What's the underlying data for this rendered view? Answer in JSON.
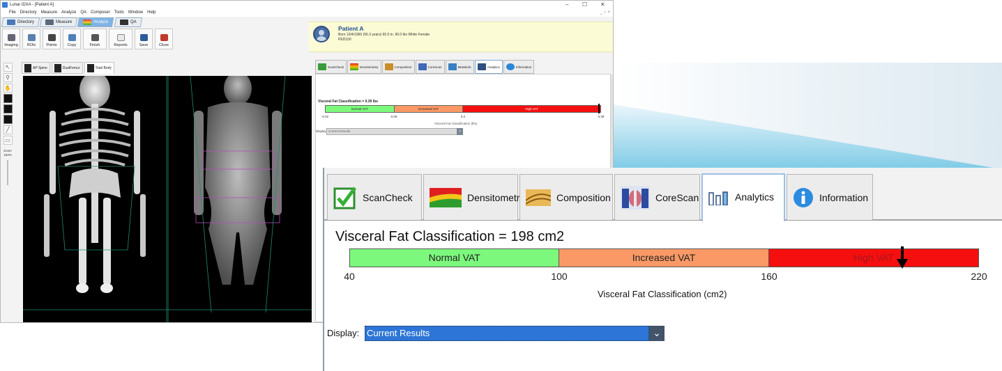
{
  "app": {
    "title": "Lunar iDXA - [Patient A]",
    "menu": [
      "File",
      "Directory",
      "Measure",
      "Analyze",
      "QA",
      "Composer",
      "Tools",
      "Window",
      "Help"
    ],
    "window_controls": [
      "–",
      "☐",
      "✕"
    ],
    "mdi_controls": "_ ♂ ×"
  },
  "main_tabs": [
    {
      "label": "Directory"
    },
    {
      "label": "Measure"
    },
    {
      "label": "Analyze"
    },
    {
      "label": "QA"
    }
  ],
  "toolbar": [
    {
      "label": "Imaging"
    },
    {
      "label": "ROIs"
    },
    {
      "label": "Points"
    },
    {
      "label": "Copy"
    },
    {
      "label": "Finish"
    },
    {
      "label": "Reports"
    },
    {
      "label": "Save"
    },
    {
      "label": "Close"
    }
  ],
  "patient": {
    "name": "Patient A",
    "line1": "Born 10/4/1960 (56.3 years)   65.0 in. 90.0 lbs   White Female",
    "line2": "PED100"
  },
  "left_tools": {
    "zoom_label": "Zoom",
    "zoom_value": "164%"
  },
  "image_tabs": [
    {
      "label": "AP Spine"
    },
    {
      "label": "DualFemur"
    },
    {
      "label": "Total Body"
    }
  ],
  "result_tabs": [
    {
      "label": "ScanCheck"
    },
    {
      "label": "Densitometry"
    },
    {
      "label": "Composition"
    },
    {
      "label": "CoreScan"
    },
    {
      "label": "Metabolic"
    },
    {
      "label": "Analytics"
    },
    {
      "label": "Information"
    }
  ],
  "small_panel": {
    "title": "Visceral Fat Classification = 0.39 lbs",
    "segments": [
      "Normal VAT",
      "Increased VAT",
      "High VAT"
    ],
    "ticks": [
      "-0.02",
      "0.09",
      "0.2",
      "0.39"
    ],
    "axis_label": "Visceral Fat Classification (lbs)",
    "display_label": "Display",
    "display_value": "Current Results",
    "marker_fraction": 0.99
  },
  "zoom_tabs": [
    {
      "label": "ScanCheck"
    },
    {
      "label": "Densitometry"
    },
    {
      "label": "Composition"
    },
    {
      "label": "CoreScan"
    },
    {
      "label": "Analytics"
    },
    {
      "label": "Information"
    }
  ],
  "zoom_panel": {
    "title": "Visceral Fat Classification = 198 cm2",
    "segments": [
      "Normal VAT",
      "Increased VAT",
      "High VAT"
    ],
    "ticks": [
      "40",
      "100",
      "160",
      "220"
    ],
    "axis_label": "Visceral Fat Classification (cm2)",
    "display_label": "Display:",
    "display_value": "Current Results",
    "marker_value": 198,
    "range": [
      40,
      220
    ]
  },
  "colors": {
    "normal": "#7cf97c",
    "increased": "#fb9966",
    "high": "#f50f0f",
    "accent": "#2d75d6",
    "patient_bg": "#fbfbd6"
  }
}
